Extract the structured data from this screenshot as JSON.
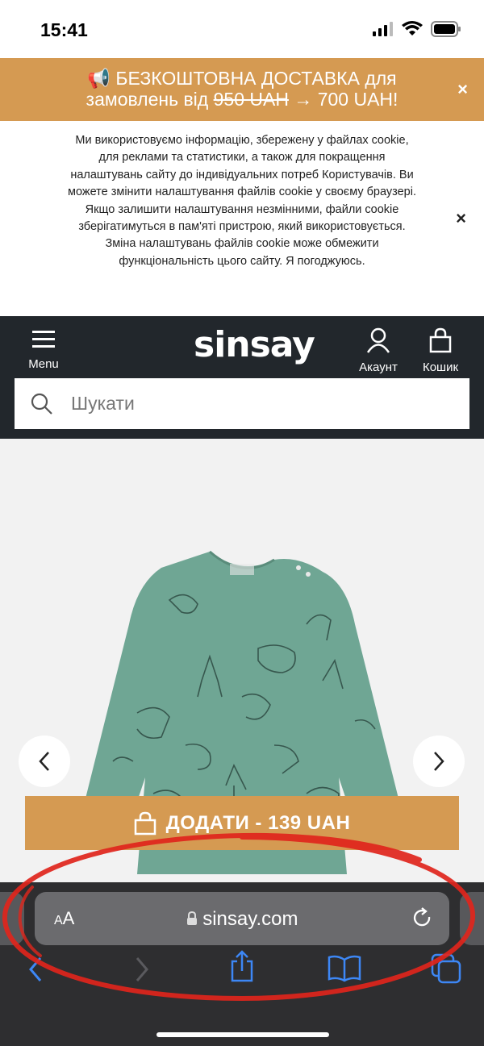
{
  "status_bar": {
    "time": "15:41"
  },
  "promo": {
    "line1": "📢 БЕЗКОШТОВНА ДОСТАВКА для",
    "line2_prefix": "замовлень від ",
    "old_price": "950 UAH",
    "line2_suffix": " → 700 UAH!",
    "close": "×"
  },
  "cookie": {
    "text": "Ми використовуємо інформацію, збережену у файлах cookie, для реклами та статистики, а також для покращення налаштувань сайту до індивідуальних потреб Користувачів. Ви можете змінити налаштування файлів cookie у своєму браузері. Якщо залишити налаштування незмінними, файли cookie зберігатимуться в пам'яті пристрою, який використовується. Зміна налаштувань файлів cookie може обмежити функціональність цього сайту. Я погоджуюсь.",
    "close": "×"
  },
  "header": {
    "menu_label": "Menu",
    "logo": "sinsay",
    "account_label": "Акаунт",
    "cart_label": "Кошик"
  },
  "search": {
    "placeholder": "Шукати"
  },
  "product": {
    "add_button": "ДОДАТИ - 139 UAH"
  },
  "browser": {
    "aa_small": "A",
    "aa_large": "A",
    "url": "sinsay.com"
  },
  "colors": {
    "accent": "#d59a52",
    "header_bg": "#22272c",
    "shirt": "#6fa694",
    "annotation": "#e0251c",
    "browser_bg": "#2e2e30",
    "safari_blue": "#3d87f5"
  }
}
